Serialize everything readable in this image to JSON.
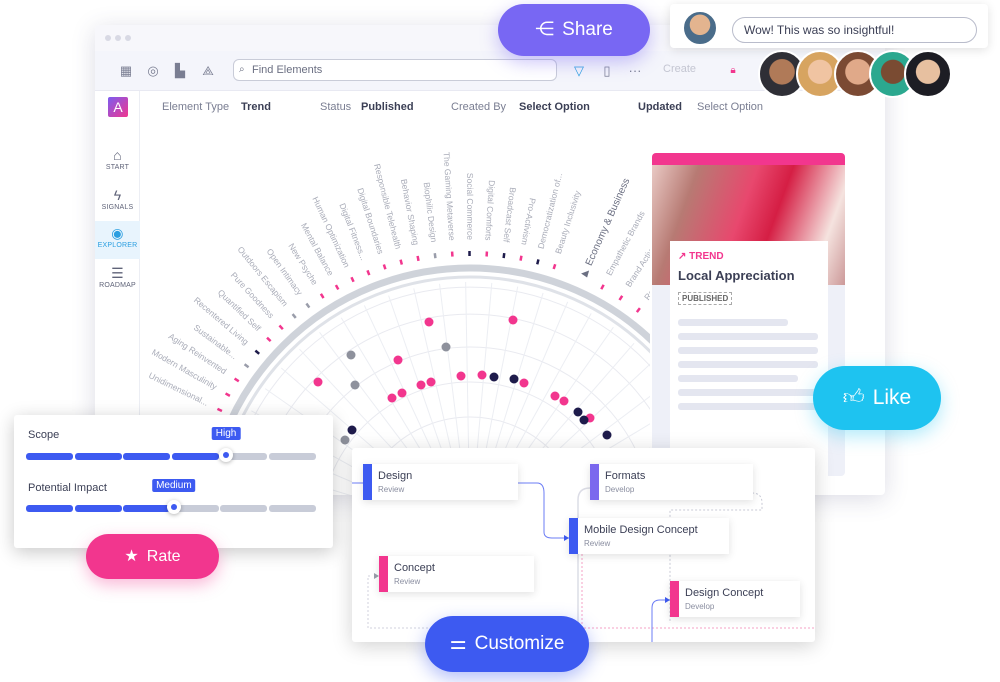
{
  "window": {
    "toolbar": {
      "search_placeholder": "Find Elements",
      "create_label": "Create",
      "icons": [
        "grid-icon",
        "radar-icon",
        "chart-icon",
        "network-icon",
        "filter-icon",
        "bookmark-icon",
        "more-icon",
        "lock-icon"
      ]
    },
    "filters": [
      {
        "label": "Element Type",
        "value": "Trend"
      },
      {
        "label": "Status",
        "value": "Published"
      },
      {
        "label": "Created By",
        "value": "Select Option"
      },
      {
        "label": "Updated",
        "value": "Select Option"
      }
    ],
    "logo": "A",
    "sidebar": {
      "items": [
        {
          "label": "START",
          "icon": "home-icon"
        },
        {
          "label": "SIGNALS",
          "icon": "signals-icon"
        },
        {
          "label": "EXPLORER",
          "icon": "compass-icon",
          "active": true
        },
        {
          "label": "ROADMAP",
          "icon": "roadmap-icon"
        }
      ]
    }
  },
  "radar": {
    "labels": [
      {
        "text": "Unidimensional...",
        "color": "#f2368e"
      },
      {
        "text": "Modern Masculinity",
        "color": "#f2368e"
      },
      {
        "text": "Aging Reinvented",
        "color": "#f2368e"
      },
      {
        "text": "Sustainable...",
        "color": "#9a9daa"
      },
      {
        "text": "Recentered Living",
        "color": "#1e1b4b"
      },
      {
        "text": "Quantified Self",
        "color": "#f2368e"
      },
      {
        "text": "Pure Goodness",
        "color": "#f2368e"
      },
      {
        "text": "Outdoors Escapism",
        "color": "#9a9daa"
      },
      {
        "text": "Open Intimacy",
        "color": "#9a9daa"
      },
      {
        "text": "New Psyche",
        "color": "#f2368e"
      },
      {
        "text": "Mental Balance",
        "color": "#f2368e"
      },
      {
        "text": "Human Optimization",
        "color": "#f2368e"
      },
      {
        "text": "Digital Fitness...",
        "color": "#f2368e"
      },
      {
        "text": "Digital Boundaries",
        "color": "#f2368e"
      },
      {
        "text": "Responsible Telehealth",
        "color": "#f2368e"
      },
      {
        "text": "Behavior Shaping",
        "color": "#f2368e"
      },
      {
        "text": "Biophilic Design",
        "color": "#9a9daa"
      },
      {
        "text": "The Gaming Metaverse",
        "color": "#f2368e"
      },
      {
        "text": "Social Commerce",
        "color": "#1e1b4b"
      },
      {
        "text": "Digital Comforts",
        "color": "#f2368e"
      },
      {
        "text": "Broadcast Self",
        "color": "#1e1b4b"
      },
      {
        "text": "Pro-Activism",
        "color": "#f2368e"
      },
      {
        "text": "Democratization of...",
        "color": "#1e1b4b"
      },
      {
        "text": "Beauty Inclusivity",
        "color": "#f2368e"
      },
      {
        "text": "Economy & Business",
        "color": "#6b6f82",
        "category": true
      },
      {
        "text": "Empathetic Brands",
        "color": "#f2368e"
      },
      {
        "text": "Brand Activ...",
        "color": "#f2368e"
      },
      {
        "text": "Re...",
        "color": "#f2368e"
      }
    ]
  },
  "card": {
    "type": "TREND",
    "title": "Local Appreciation",
    "status": "PUBLISHED"
  },
  "share": {
    "label": "Share",
    "icon": "share-icon",
    "color": "#7867f3"
  },
  "comment": {
    "value": "Wow! This was so insightful!"
  },
  "like": {
    "label": "Like",
    "icon": "thumbs-up-icon",
    "color": "#1ec3f0"
  },
  "sliders": [
    {
      "label": "Scope",
      "value_label": "High",
      "level": 0.69
    },
    {
      "label": "Potential Impact",
      "value_label": "Medium",
      "level": 0.51
    }
  ],
  "rate": {
    "label": "Rate",
    "icon": "star-icon",
    "color": "#f2368e"
  },
  "flow": {
    "nodes": [
      {
        "title": "Design",
        "stage": "Review",
        "color": "#3d5af1"
      },
      {
        "title": "Formats",
        "stage": "Develop",
        "color": "#7b68ee"
      },
      {
        "title": "Mobile Design Concept",
        "stage": "Review",
        "color": "#3d5af1"
      },
      {
        "title": "Concept",
        "stage": "Review",
        "color": "#f2368e"
      },
      {
        "title": "Design Concept",
        "stage": "Develop",
        "color": "#f2368e"
      }
    ]
  },
  "customize": {
    "label": "Customize",
    "icon": "sliders-icon",
    "color": "#3d5af1"
  }
}
